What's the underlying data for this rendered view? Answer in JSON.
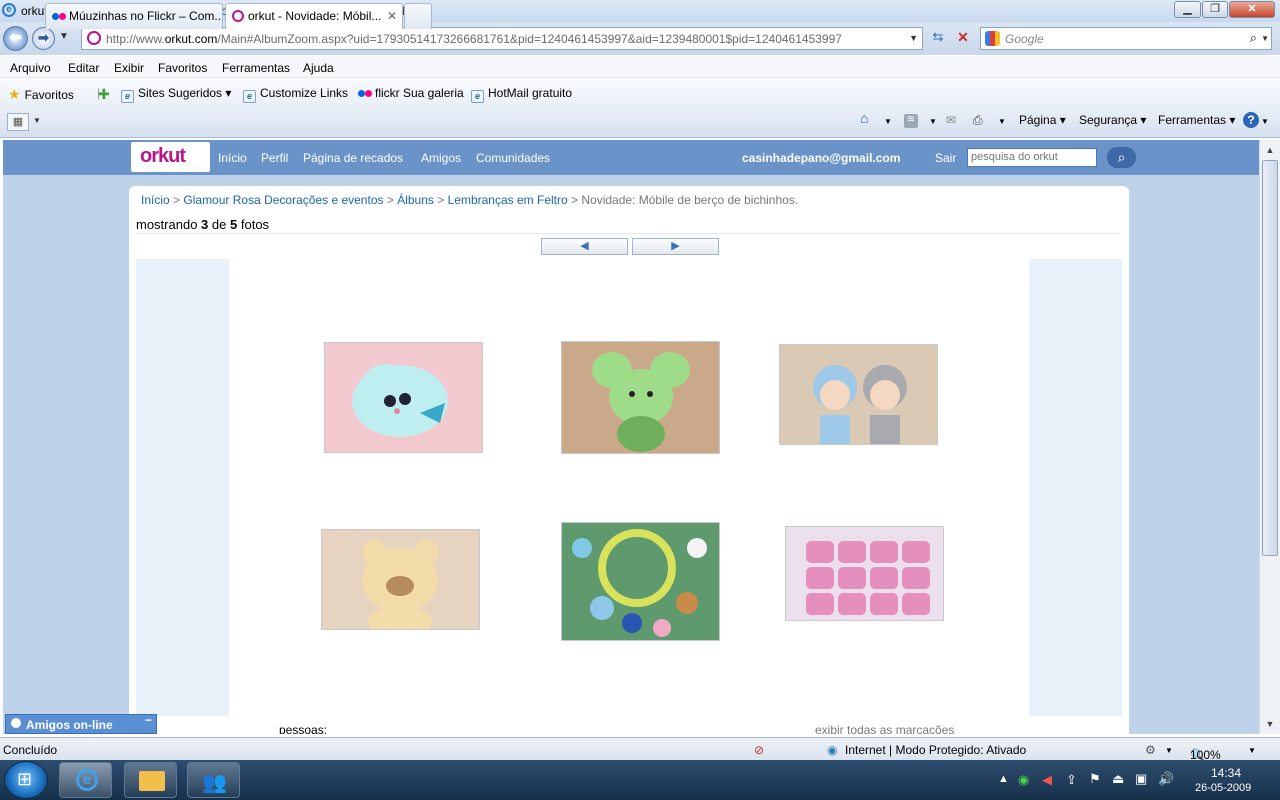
{
  "window": {
    "title": "orkut - Novidade: Móbile de berço de bichinhos. - Windows Internet Explorer",
    "minimize": "▁",
    "restore": "❐",
    "close": "✕"
  },
  "address": {
    "url_prefix": "http://www.",
    "url_domain": "orkut.com",
    "url_rest": "/Main#AlbumZoom.aspx?uid=17930514173266681761&pid=1240461453997&aid=1239480001$pid=1240461453997",
    "search_placeholder": "Google"
  },
  "menu": [
    "Arquivo",
    "Editar",
    "Exibir",
    "Favoritos",
    "Ferramentas",
    "Ajuda"
  ],
  "favorites": {
    "label": "Favoritos",
    "items": [
      "Sites Sugeridos ▾",
      "Customize Links",
      "flickr Sua galeria",
      "HotMail gratuito"
    ]
  },
  "tabs": [
    {
      "label": "Múuzinhas no Flickr – Com..."
    },
    {
      "label": "orkut - Novidade: Móbil..."
    }
  ],
  "commands": [
    "Página ▾",
    "Segurança ▾",
    "Ferramentas ▾"
  ],
  "orkut": {
    "logo": "orkut",
    "nav": [
      "Início",
      "Perfil",
      "Página de recados",
      "Amigos",
      "Comunidades"
    ],
    "email": "casinhadepano@gmail.com",
    "logout": "Sair",
    "search_placeholder": "pesquisa do orkut"
  },
  "breadcrumb": {
    "items": [
      "Início",
      "Glamour Rosa Decorações e eventos",
      "Álbuns",
      "Lembranças em Feltro"
    ],
    "current": "Novidade: Móbile de berço de bichinhos.",
    "separator": ">"
  },
  "photo_count": {
    "prefix": "mostrando",
    "current": "3",
    "middle": "de",
    "total": "5",
    "suffix": "fotos"
  },
  "pager": {
    "prev": "◀",
    "next": "▶"
  },
  "photo_tiles": [
    {
      "colors": [
        "#f2c9cf",
        "#bfeef0",
        "#d98aa0"
      ]
    },
    {
      "colors": [
        "#c9a989",
        "#9fdc8a",
        "#6fae5a"
      ]
    },
    {
      "colors": [
        "#d9c9b5",
        "#9fc9e8",
        "#a9a9b0"
      ]
    },
    {
      "colors": [
        "#e6d3c0",
        "#f3dcaa",
        "#b88a60"
      ]
    },
    {
      "colors": [
        "#5f9a6e",
        "#d8e25a",
        "#f3f3f3"
      ]
    },
    {
      "colors": [
        "#ece0ee",
        "#e58fbc",
        "#f7d2e4"
      ]
    }
  ],
  "photo_footer": {
    "people": "pessoas:",
    "all_marks": "exibir todas as marcações"
  },
  "online_friends": "Amigos on-line",
  "status": {
    "left": "Concluído",
    "zone": "Internet | Modo Protegido: Ativado",
    "zoom": "100%"
  },
  "clock": {
    "time": "14:34",
    "date": "26-05-2009"
  }
}
